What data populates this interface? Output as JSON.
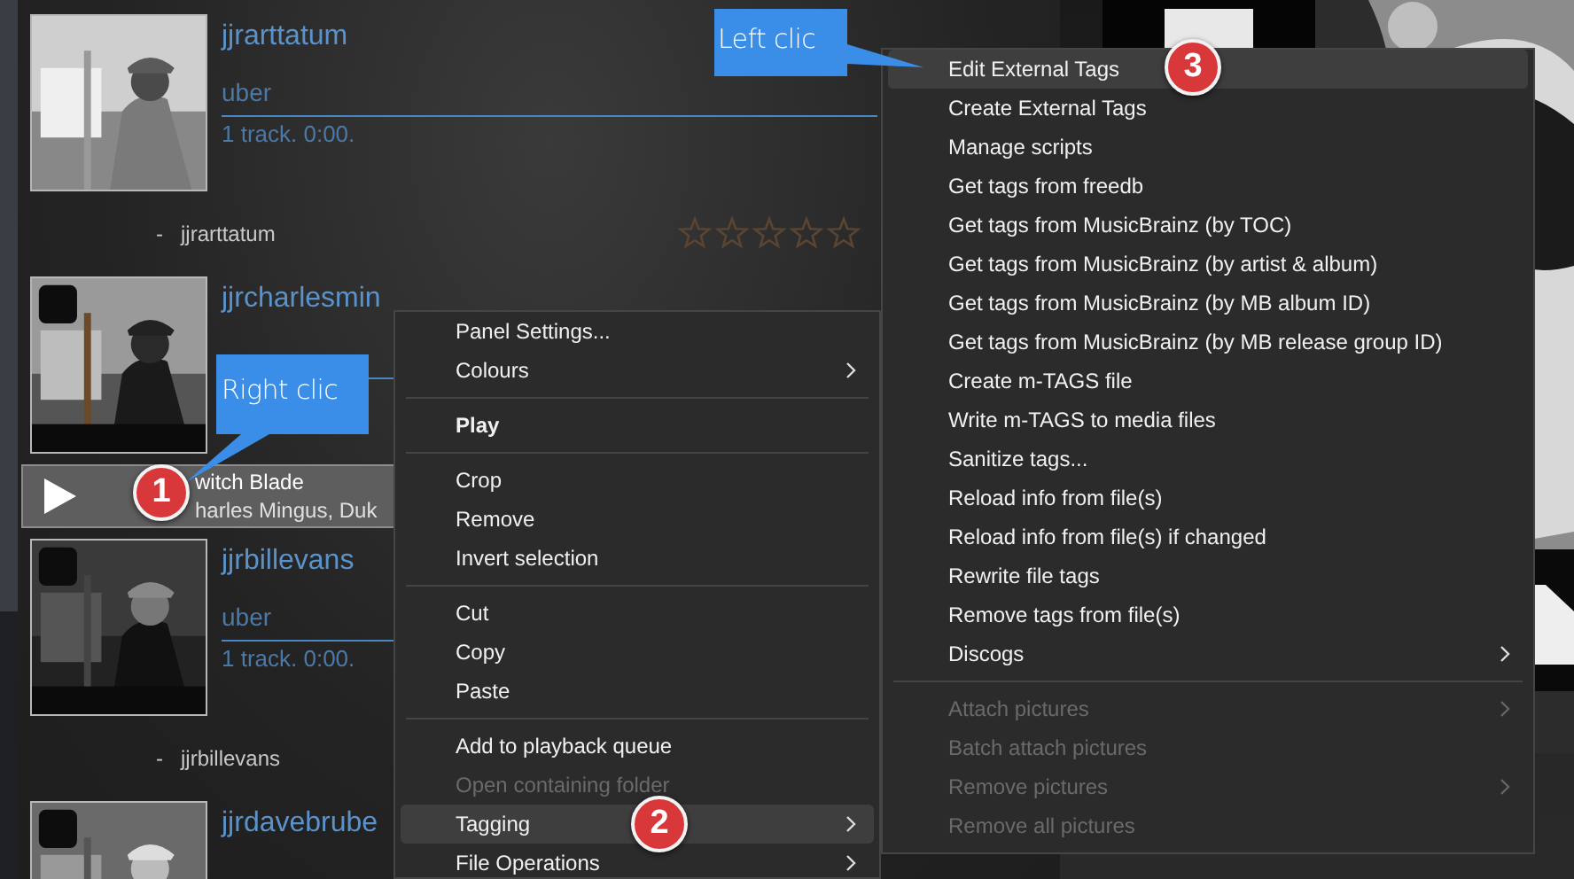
{
  "playlist": {
    "groups": [
      {
        "title": "jjrarttatum",
        "album": "uber",
        "info": "1 track. 0:00.",
        "art": {
          "kind": "picture"
        },
        "tracks": [
          {
            "kind": "plain",
            "dash": "-",
            "label": "jjrarttatum",
            "selected": false,
            "stars": 0
          }
        ]
      },
      {
        "title": "jjrcharlesmin",
        "art": {
          "kind": "picture"
        },
        "tracks": [
          {
            "kind": "now",
            "title": "witch Blade",
            "artist": "harles Mingus, Duk",
            "selected": true
          }
        ]
      },
      {
        "title": "jjrbillevans",
        "album": "uber",
        "info": "1 track. 0:00.",
        "art": {
          "kind": "picture"
        },
        "tracks": [
          {
            "kind": "plain",
            "dash": "-",
            "label": "jjrbillevans",
            "selected": false
          }
        ]
      },
      {
        "title": "jjrdavebrube",
        "art": {
          "kind": "picture"
        }
      }
    ]
  },
  "photo": {
    "kind": "picture"
  },
  "context_menu": {
    "items": [
      {
        "kind": "item",
        "label": "Panel Settings...",
        "selected": false,
        "disabled": false,
        "submenu": false
      },
      {
        "kind": "item",
        "label": "Colours",
        "selected": false,
        "disabled": false,
        "submenu": true
      },
      {
        "kind": "separator"
      },
      {
        "kind": "default",
        "label": "Play",
        "selected": false,
        "disabled": false,
        "submenu": false
      },
      {
        "kind": "separator"
      },
      {
        "kind": "item",
        "label": "Crop",
        "selected": false,
        "disabled": false,
        "submenu": false
      },
      {
        "kind": "item",
        "label": "Remove",
        "selected": false,
        "disabled": false,
        "submenu": false
      },
      {
        "kind": "item",
        "label": "Invert selection",
        "selected": false,
        "disabled": false,
        "submenu": false
      },
      {
        "kind": "separator"
      },
      {
        "kind": "item",
        "label": "Cut",
        "selected": false,
        "disabled": false,
        "submenu": false
      },
      {
        "kind": "item",
        "label": "Copy",
        "selected": false,
        "disabled": false,
        "submenu": false
      },
      {
        "kind": "item",
        "label": "Paste",
        "selected": false,
        "disabled": false,
        "submenu": false
      },
      {
        "kind": "separator"
      },
      {
        "kind": "item",
        "label": "Add to playback queue",
        "selected": false,
        "disabled": false,
        "submenu": false
      },
      {
        "kind": "item",
        "label": "Open containing folder",
        "selected": false,
        "disabled": true,
        "submenu": false
      },
      {
        "kind": "item",
        "label": "Tagging",
        "selected": true,
        "disabled": false,
        "submenu": true
      },
      {
        "kind": "item",
        "label": "File Operations",
        "selected": false,
        "disabled": false,
        "submenu": true
      }
    ]
  },
  "tagging_submenu": {
    "items": [
      {
        "kind": "item",
        "label": "Edit External Tags",
        "selected": true,
        "disabled": false,
        "submenu": false
      },
      {
        "kind": "item",
        "label": "Create External Tags",
        "selected": false,
        "disabled": false,
        "submenu": false
      },
      {
        "kind": "item",
        "label": "Manage scripts",
        "selected": false,
        "disabled": false,
        "submenu": false
      },
      {
        "kind": "item",
        "label": "Get tags from freedb",
        "selected": false,
        "disabled": false,
        "submenu": false
      },
      {
        "kind": "item",
        "label": "Get tags from MusicBrainz (by TOC)",
        "selected": false,
        "disabled": false,
        "submenu": false
      },
      {
        "kind": "item",
        "label": "Get tags from MusicBrainz (by artist & album)",
        "selected": false,
        "disabled": false,
        "submenu": false
      },
      {
        "kind": "item",
        "label": "Get tags from MusicBrainz (by MB album ID)",
        "selected": false,
        "disabled": false,
        "submenu": false
      },
      {
        "kind": "item",
        "label": "Get tags from MusicBrainz (by MB release group ID)",
        "selected": false,
        "disabled": false,
        "submenu": false
      },
      {
        "kind": "item",
        "label": "Create m-TAGS file",
        "selected": false,
        "disabled": false,
        "submenu": false
      },
      {
        "kind": "item",
        "label": "Write m-TAGS to media files",
        "selected": false,
        "disabled": false,
        "submenu": false
      },
      {
        "kind": "item",
        "label": "Sanitize tags...",
        "selected": false,
        "disabled": false,
        "submenu": false
      },
      {
        "kind": "item",
        "label": "Reload info from file(s)",
        "selected": false,
        "disabled": false,
        "submenu": false
      },
      {
        "kind": "item",
        "label": "Reload info from file(s) if changed",
        "selected": false,
        "disabled": false,
        "submenu": false
      },
      {
        "kind": "item",
        "label": "Rewrite file tags",
        "selected": false,
        "disabled": false,
        "submenu": false
      },
      {
        "kind": "item",
        "label": "Remove tags from file(s)",
        "selected": false,
        "disabled": false,
        "submenu": false
      },
      {
        "kind": "item",
        "label": "Discogs",
        "selected": false,
        "disabled": false,
        "submenu": true
      },
      {
        "kind": "separator"
      },
      {
        "kind": "item",
        "label": "Attach pictures",
        "selected": false,
        "disabled": true,
        "submenu": true
      },
      {
        "kind": "item",
        "label": "Batch attach pictures",
        "selected": false,
        "disabled": true,
        "submenu": false
      },
      {
        "kind": "item",
        "label": "Remove pictures",
        "selected": false,
        "disabled": true,
        "submenu": true
      },
      {
        "kind": "item",
        "label": "Remove all pictures",
        "selected": false,
        "disabled": true,
        "submenu": false
      }
    ]
  },
  "callouts": [
    {
      "kind": "right",
      "text": "Left clic"
    },
    {
      "kind": "down",
      "text": "Right clic"
    }
  ],
  "steps": [
    {
      "number": "1"
    },
    {
      "number": "2"
    },
    {
      "number": "3"
    }
  ]
}
